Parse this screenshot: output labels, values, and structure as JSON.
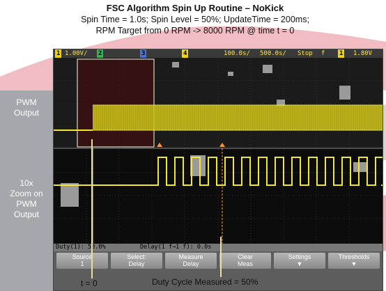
{
  "figure": {
    "title": "FSC Algorithm Spin Up Routine – NoKick",
    "subtitle_line1": "Spin Time = 1.0s; Spin Level = 50%; UpdateTime = 200ms;",
    "subtitle_line2": "RPM Target from 0 RPM -> 8000 RPM @ time t = 0",
    "label_pwm_output": [
      "PWM",
      "Output"
    ],
    "label_zoom": [
      "10x",
      "Zoom on",
      "PWM",
      "Output"
    ],
    "label_t0": "t = 0",
    "label_duty_measured": "Duty Cycle Measured = 50%"
  },
  "scope": {
    "status": {
      "ch1_num": "1",
      "ch1_scale": "1.00V/",
      "ch2_num": "2",
      "ch3_num": "3",
      "ch4_num": "4",
      "timebase": "100.0s/",
      "time_per_div": "500.0s/",
      "run_state": "Stop",
      "trigger_icon": "f",
      "trig_ch": "1",
      "trig_level": "1.80V"
    },
    "measurements": {
      "duty": "Duty(1): 50.0%",
      "delay": "Delay(1 f→1 f): 0.0s"
    },
    "softkeys": [
      {
        "l1": "Source",
        "l2": "1"
      },
      {
        "l1": "Select:",
        "l2": "Delay"
      },
      {
        "l1": "Measure",
        "l2": "Delay"
      },
      {
        "l1": "Clear",
        "l2": "Meas"
      },
      {
        "l1": "Settings",
        "l2": ""
      },
      {
        "l1": "Thresholds",
        "l2": ""
      }
    ],
    "colors": {
      "trace": "#f2e830",
      "grid": "#5a5a5a",
      "background": "#0c0c0c",
      "marker_orange": "#ff9a2a"
    }
  }
}
